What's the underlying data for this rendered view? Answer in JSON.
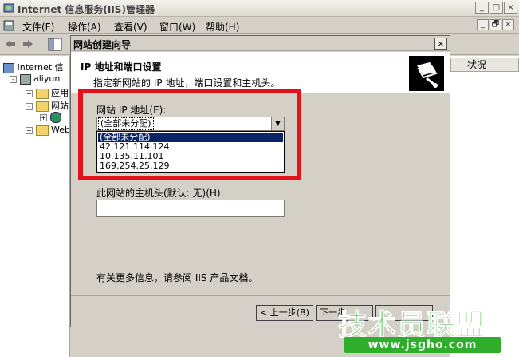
{
  "window": {
    "title": "Internet 信息服务(IIS)管理器",
    "min_label": "_",
    "max_label": "□",
    "close_label": "×",
    "child_min_label": "_",
    "child_restore_label": "🗗",
    "child_close_label": "×"
  },
  "menu": {
    "items": [
      {
        "label": "文件(F)"
      },
      {
        "label": "操作(A)"
      },
      {
        "label": "查看(V)"
      },
      {
        "label": "窗口(W)"
      },
      {
        "label": "帮助(H)"
      }
    ]
  },
  "tree": {
    "root": "Internet 信",
    "server": "aliyun",
    "node_app": "应用",
    "node_sites": "网站",
    "node_web": "Web"
  },
  "rightpane": {
    "column_status": "状况"
  },
  "dialog": {
    "title": "网站创建向导",
    "close_label": "×",
    "header_title": "IP 地址和端口设置",
    "header_subtitle": "指定新网站的 IP 地址，端口设置和主机头。",
    "ip_label": "网站 IP 地址(E):",
    "ip_selected": "(全部未分配)",
    "ip_options": [
      {
        "label": "(全部未分配)"
      },
      {
        "label": "42.121.114.124"
      },
      {
        "label": "10.135.11.101"
      },
      {
        "label": "169.254.25.129"
      }
    ],
    "host_label": "此网站的主机头(默认: 无)(H):",
    "host_value": "",
    "info_text": "有关更多信息，请参阅 IIS 产品文档。",
    "back_button": "< 上一步(B)",
    "next_button": "下一步"
  },
  "watermark": {
    "text": "技术员联盟",
    "url": "www.jsgho.com"
  },
  "colors": {
    "highlight": "#e3111a",
    "selection": "#0a246a",
    "watermark_green": "#2fae2c"
  }
}
